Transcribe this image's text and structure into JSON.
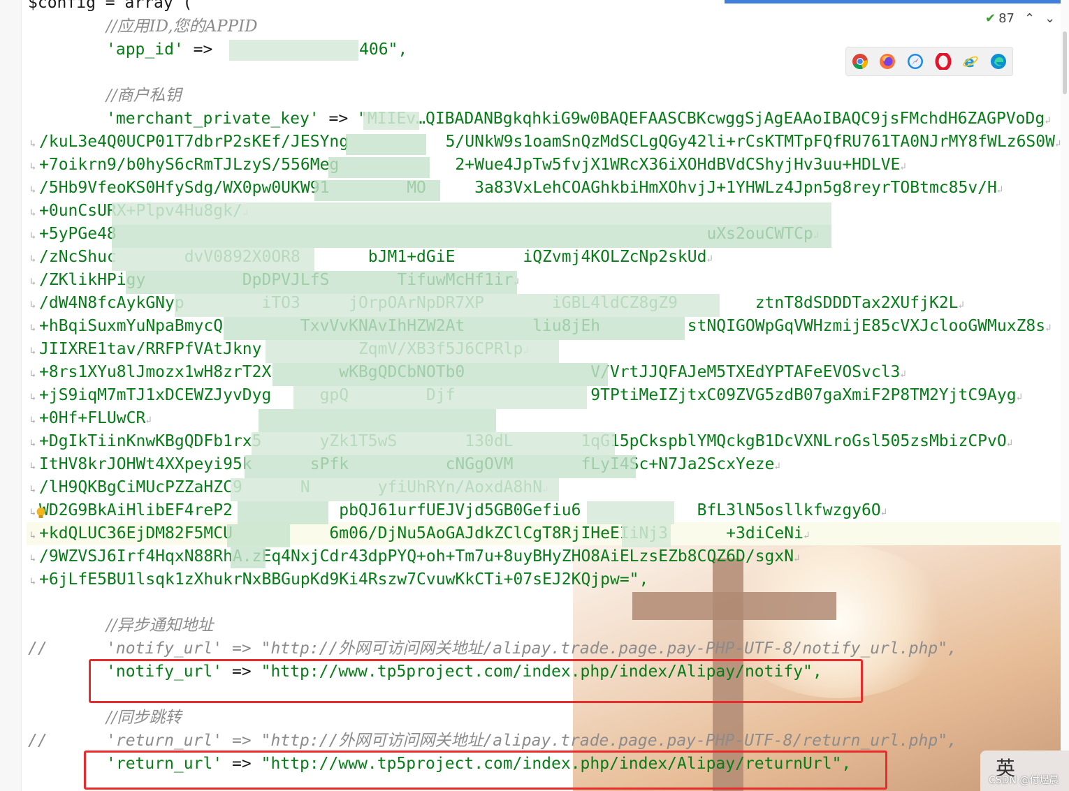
{
  "toolbar": {
    "inspection_count": "87",
    "browsers": [
      "chrome-icon",
      "firefox-icon",
      "safari-icon",
      "opera-icon",
      "ie-icon",
      "edge-icon"
    ]
  },
  "code": {
    "header": "$config = array (",
    "app_id_comment": "//应用ID,您的APPID",
    "app_id_key": "'app_id'",
    "app_id_arrow": "=>",
    "app_id_value_tail": "406\",",
    "private_key_comment": "//商户私钥",
    "private_key_key": "'merchant_private_key'",
    "private_key_arrow": "=>",
    "private_key_first": "\"MIIEv…QIBADANBgkqhkiG9w0BAQEFAASCBKcwggSjAgEAAoIBAQC9jsFMchdH6ZAGPVoDg",
    "key_lines": [
      "/kuL3e4Q0UCP01T7dbrP2sKEf/JESYng          5/UNkW9s1oamSnQzMdSCLgQGy42li+rCsKTMTpFQfRU761TA0NJrMY8fWLz6S0W",
      "+7oikrn9/b0hyS6cRmTJLzyS/556Meg            2+Wue4JpTw5fvjX1WRcX36iXOHdBVdCShyjHv3uu+HDLVE",
      "/5Hb9VfeoKS0HfySdg/WX0pw0UKW91        MO     3a83VxLehCOAGhkbiHmXOhvjJ+1YHWLz4Jpn5g8reyrTOBtmc85v/H",
      "+0unCsURX+Plpv4Hu8gk/",
      "+5yPGe48                                                             uXs2ouCWTCp",
      "/zNcShuc       dvV0892X0OR8       bJM1+dGiE       iQZvmj4KOLZcNp2skUd",
      "/ZKlikHPigy          DpDPVJLfS       TifuwMcHf1ir",
      "/dW4N8fcAykGNyp        iTO3     jOrpOArNpDR7XP       iGBL4ldCZ8gZ9        ztnT8dSDDDTax2XUfjK2L",
      "+hBqiSuxmYuNpaBmycQ        TxvVvKNAvIhHZW2At       liu8jEh         stNQIGOWpGqVWHzmijE85cVXJclooGWMuxZ8s",
      "JIIXRE1tav/RRFPfVAtJkny          ZqmV/XB3f5J6CPRlp",
      "+8rs1XYu8lJmozx1wH8zrT2X       wKBgQDCbNOTb0             V/VrtJJQFAJeM5TXEdYPTAFeEVOSvcl3",
      "+jS9iqM7mTJ1xDCEWZJyvDyg     gpQ        Djf              9TPtiMeIZjtxC09ZVG5zdB07gaXmiF2P8TM2YjtC9Ayg",
      "+0Hf+FLUwCR",
      "+DgIkTiinKnwKBgQDFb1rx5      yZk1T5wS       130dL       1qG15pCkspblYMQckgB1DcVXNLroGsl505zsMbizCPvO",
      "ItHV8krJOHWt4XXpeyi95k      sPfk          cNGgOVM       fLyI4Sc+N7Ja2ScxYeze",
      "/lH9QKBgCiMUcPZZaHZC9      N       yfiUhRYn/AoxdA8hN",
      "WD2G9BkAiHlibEF4reP2           pbQJ61urfUEJVjd5GB0Gefiu6            BfL3lN5osllkfwzgy6O",
      "+kdQLUC36EjDM82F5MCU          6m06/DjNu5AoGAJdkZClCgT8RjIHeEIiNj3      +3diCeNi",
      "/9WZVSJ6Irf4HqxN88RhA.zEq4NxjCdr43dpPYQ+oh+Tm7u+8uyBHyZHO8AiELzsEZb8CQZ6D/sgxN",
      "+6jLfE5BU1lsqk1zXhukrNxBBGupKd9Ki4Rszw7CvuwKkCTi+07sEJ2KQjpw=\","
    ],
    "notify_comment": "//异步通知地址",
    "notify_old_prefix": "//",
    "notify_old_key": "'notify_url'",
    "notify_old_arrow": "=>",
    "notify_old_value": "\"http://外网可访问网关地址/alipay.trade.page.pay-PHP-UTF-8/notify_url.php\",",
    "notify_key": "'notify_url'",
    "notify_arrow": "=>",
    "notify_value": "\"http://www.tp5project.com/index.php/index/Alipay/notify\",",
    "return_comment": "//同步跳转",
    "return_old_prefix": "//",
    "return_old_key": "'return_url'",
    "return_old_arrow": "=>",
    "return_old_value": "\"http://外网可访问网关地址/alipay.trade.page.pay-PHP-UTF-8/return_url.php\",",
    "return_key": "'return_url'",
    "return_arrow": "=>",
    "return_value": "\"http://www.tp5project.com/index.php/index/Alipay/returnUrl\","
  },
  "watermark": {
    "logo": "英",
    "text": "CSDN @付煜晨"
  },
  "colors": {
    "string_green": "#067d17",
    "comment_gray": "#8c8c8c",
    "highlight_red": "#e82c2c",
    "tab_blue": "#3f7fd9"
  }
}
